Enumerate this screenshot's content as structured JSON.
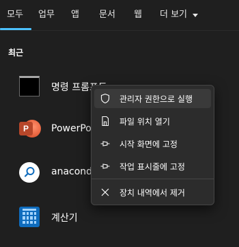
{
  "tabs": [
    {
      "label": "모두",
      "active": true
    },
    {
      "label": "업무"
    },
    {
      "label": "앱"
    },
    {
      "label": "문서"
    },
    {
      "label": "웹"
    },
    {
      "label": "더 보기"
    }
  ],
  "section": {
    "title": "최근"
  },
  "results": [
    {
      "name": "명령 프롬프트",
      "icon": "command-prompt-icon"
    },
    {
      "name": "PowerPoint",
      "icon": "powerpoint-icon"
    },
    {
      "name": "anaconda",
      "icon": "anaconda-search-icon"
    },
    {
      "name": "계산기",
      "icon": "calculator-icon"
    }
  ],
  "context_menu": {
    "items": [
      {
        "label": "관리자 권한으로 실행",
        "icon": "shield-icon"
      },
      {
        "label": "파일 위치 열기",
        "icon": "document-icon"
      },
      {
        "label": "시작 화면에 고정",
        "icon": "pin-icon"
      },
      {
        "label": "작업 표시줄에 고정",
        "icon": "pin-icon"
      },
      {
        "label": "장치 내역에서 제거",
        "icon": "close-icon"
      }
    ]
  },
  "colors": {
    "accent": "#4cc2ff",
    "background": "#1f1f1f",
    "menu_background": "#2c2c2c"
  }
}
